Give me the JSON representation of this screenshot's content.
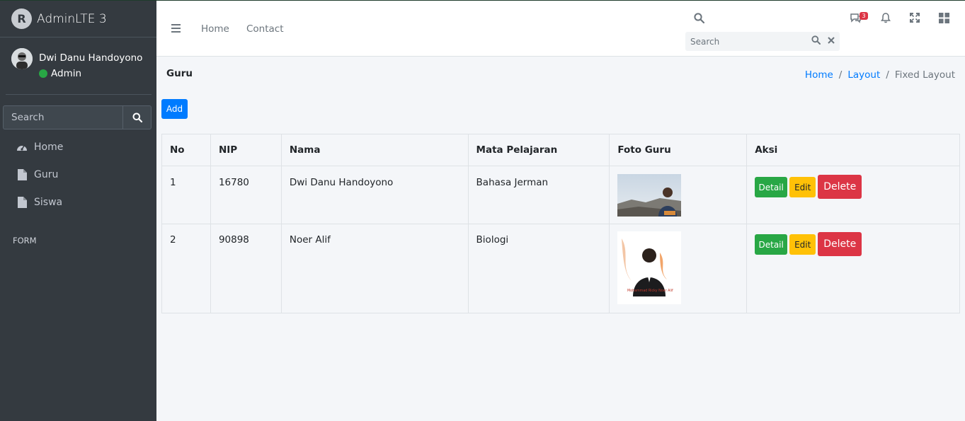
{
  "brand": {
    "name": "AdminLTE 3",
    "logo_letter": "R"
  },
  "user": {
    "name": "Dwi Danu Handoyono",
    "role": "Admin"
  },
  "sidebar": {
    "search_placeholder": "Search",
    "items": [
      {
        "label": "Home",
        "icon": "tachometer-icon"
      },
      {
        "label": "Guru",
        "icon": "file-icon"
      },
      {
        "label": "Siswa",
        "icon": "file-icon"
      }
    ],
    "header": "FORM"
  },
  "navbar": {
    "links": [
      "Home",
      "Contact"
    ],
    "search_placeholder": "Search",
    "messages_count": "3"
  },
  "page": {
    "title": "Guru",
    "breadcrumb": [
      "Home",
      "Layout",
      "Fixed Layout"
    ],
    "add_label": "Add"
  },
  "table": {
    "headers": [
      "No",
      "NIP",
      "Nama",
      "Mata Pelajaran",
      "Foto Guru",
      "Aksi"
    ],
    "rows": [
      {
        "no": "1",
        "nip": "16780",
        "nama": "Dwi Danu Handoyono",
        "mapel": "Bahasa Jerman",
        "photo_caption": ""
      },
      {
        "no": "2",
        "nip": "90898",
        "nama": "Noer Alif",
        "mapel": "Biologi",
        "photo_caption": "Mohammad Ricky Noer Alif"
      }
    ],
    "actions": {
      "detail": "Detail",
      "edit": "Edit",
      "delete": "Delete"
    }
  },
  "colors": {
    "sidebar_bg": "#343a40",
    "primary": "#007bff",
    "success": "#28a745",
    "warning": "#ffc107",
    "danger": "#dc3545"
  }
}
